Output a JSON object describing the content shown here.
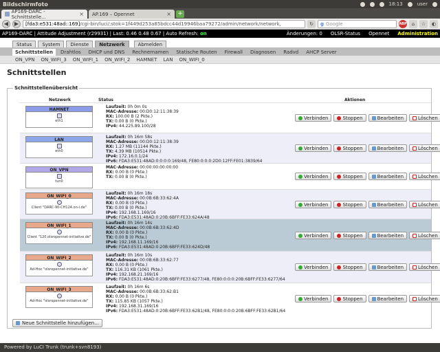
{
  "os_panel": {
    "title": "Bildschirmfoto",
    "clock": "18:13",
    "user": "user"
  },
  "browser": {
    "tabs": [
      {
        "label": "AP169-DARC - Schnittstelle..."
      },
      {
        "label": "AP.169 – Opennet"
      }
    ],
    "url_host": "[fda3:e531:48ad::169]",
    "url_path": "/cgi-bin/luci/;stok=1f449d253a85bdcc44d19946baa79272/admin/network/network,",
    "search_placeholder": "Google",
    "abp_label": "ABP"
  },
  "luci_header": {
    "info": "AP169-DARC | Attitude Adjustment (r29931) | Last: 0.46 0.48 0.67 | Auto Refresh:",
    "auto_refresh": "on",
    "changes": "Änderungen: 0",
    "olsr": "OLSR-Status",
    "opennet": "Opennet",
    "administration": "Administration"
  },
  "main_tabs": [
    "Status",
    "System",
    "Dienste",
    "Netzwerk",
    "Abmelden"
  ],
  "sub_tabs": [
    "Schnittstellen",
    "Drahtlos",
    "DHCP und DNS",
    "Rechnernamen",
    "Statische Routen",
    "Firewall",
    "Diagnosen",
    "Radvd",
    "AHCP Server"
  ],
  "interface_tabs": [
    "ON_VPN",
    "ON_WIFI_3",
    "ON_WIFI_1",
    "ON_WIFI_2",
    "HAMNET",
    "LAN",
    "ON_WIFI_0"
  ],
  "page_title": "Schnittstellen",
  "overview": {
    "legend": "Schnittstellenübersicht",
    "col_network": "Netzwerk",
    "col_status": "Status",
    "col_actions": "Aktionen",
    "actions": {
      "connect": "Verbinden",
      "stop": "Stoppen",
      "edit": "Bearbeiten",
      "delete": "Löschen"
    },
    "rows": [
      {
        "name": "HAMNET",
        "color": "#8c9ce8",
        "device": "eth1",
        "lines": [
          [
            "Laufzeit:",
            " 0h 0m 0s"
          ],
          [
            "MAC-Adresse:",
            " 00:D0:12:11:38:39"
          ],
          [
            "RX:",
            " 100.00 B (2 Pkte.)"
          ],
          [
            "TX:",
            " 0.00 B (0 Pkte.)"
          ],
          [
            "IPv4:",
            " 44.225.89.100/28"
          ]
        ]
      },
      {
        "name": "LAN",
        "color": "#8ca8e8",
        "device": "eth0",
        "lines": [
          [
            "Laufzeit:",
            " 0h 16m 58s"
          ],
          [
            "MAC-Adresse:",
            " 00:D0:12:11:38:39"
          ],
          [
            "RX:",
            " 1.27 MB (11144 Pkte.)"
          ],
          [
            "TX:",
            " 4.39 MB (10514 Pkte.)"
          ],
          [
            "IPv4:",
            " 172.16.0.1/24"
          ],
          [
            "IPv6:",
            " FDA3:E531:48AD:0:0:0:0:169/48, FE80:0:0:0:2D0:12FF:FE01:3839/64"
          ]
        ]
      },
      {
        "name": "ON_VPN",
        "color": "#b0a8e8",
        "device": "tun0",
        "lines": [
          [
            "MAC-Adresse:",
            " 00:00:00:00:00:00"
          ],
          [
            "RX:",
            " 0.00 B (0 Pkte.)"
          ],
          [
            "TX:",
            " 0.00 B (0 Pkte.)"
          ]
        ]
      },
      {
        "name": "ON_WIFI_0",
        "color": "#e8a88c",
        "device": "Client \"DARC-90-CH124.on-i.de\"",
        "wifi": true,
        "lines": [
          [
            "Laufzeit:",
            " 0h 16m 18s"
          ],
          [
            "MAC-Adresse:",
            " 00:0B:6B:33:62:4A"
          ],
          [
            "RX:",
            " 0.00 B (0 Pkte.)"
          ],
          [
            "TX:",
            " 0.00 B (0 Pkte.)"
          ],
          [
            "IPv4:",
            " 192.168.1.169/16"
          ],
          [
            "IPv6:",
            " FDA3:E531:48AD:0:20B:6BFF:FE33:624A/48"
          ]
        ]
      },
      {
        "name": "ON_WIFI_1",
        "color": "#e8a88c",
        "device": "Client \"120.olsropennet-initiative.de\"",
        "wifi": true,
        "lines": [
          [
            "Laufzeit:",
            " 0h 16m 14s"
          ],
          [
            "MAC-Adresse:",
            " 00:0B:6B:33:62:4D"
          ],
          [
            "RX:",
            " 0.00 B (0 Pkte.)"
          ],
          [
            "TX:",
            " 0.00 B (0 Pkte.)"
          ],
          [
            "IPv4:",
            " 192.168.11.169/16"
          ],
          [
            "IPv6:",
            " FDA3:E531:48AD:0:20B:6BFF:FE33:624D/48"
          ]
        ]
      },
      {
        "name": "ON_WIFI_2",
        "color": "#e8a88c",
        "device": "Ad-Hoc \"olsropennet-initiative.de\"",
        "wifi": true,
        "lines": [
          [
            "Laufzeit:",
            " 0h 16m 10s"
          ],
          [
            "MAC-Adresse:",
            " 00:0B:6B:33:62:77"
          ],
          [
            "RX:",
            " 0.00 B (0 Pkte.)"
          ],
          [
            "TX:",
            " 116.31 KB (1061 Pkte.)"
          ],
          [
            "IPv4:",
            " 192.168.21.169/16"
          ],
          [
            "IPv6:",
            " FDA3:E531:48AD:0:20B:6BFF:FE33:6277/48, FE80:0:0:0:20B:6BFF:FE33:6277/64"
          ]
        ]
      },
      {
        "name": "ON_WIFI_3",
        "color": "#e8a88c",
        "device": "Ad-Hoc \"olsropennet-initiative.de\"",
        "wifi": true,
        "lines": [
          [
            "Laufzeit:",
            " 0h 16m 6s"
          ],
          [
            "MAC-Adresse:",
            " 00:0B:6B:33:62:B1"
          ],
          [
            "RX:",
            " 0.00 B (0 Pkte.)"
          ],
          [
            "TX:",
            " 115.85 KB (1057 Pkte.)"
          ],
          [
            "IPv4:",
            " 192.168.31.169/16"
          ],
          [
            "IPv6:",
            " FDA3:E531:48AD:0:20B:6BFF:FE33:62B1/48, FE80:0:0:0:20B:6BFF:FE33:62B1/64"
          ]
        ]
      }
    ],
    "add_button": "Neue Schnittstelle hinzufügen..."
  },
  "footer": "Powered by LuCI Trunk (trunk+svn8193)"
}
